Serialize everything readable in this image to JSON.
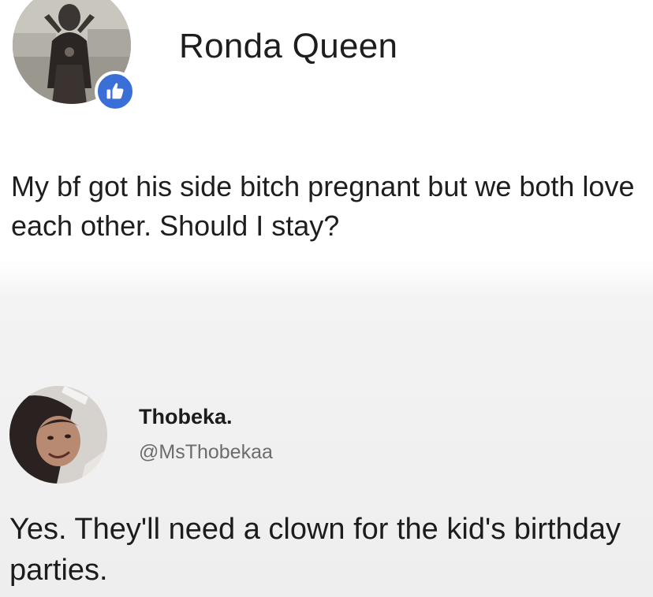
{
  "facebook_post": {
    "author_name": "Ronda Queen",
    "avatar_badge_icon": "like-thumbs-up-icon",
    "badge_color": "#3b6fd8",
    "text": "My bf got his side bitch pregnant but we both love each other. Should I stay?"
  },
  "tweet_reply": {
    "display_name": "Thobeka.",
    "handle": "@MsThobekaa",
    "text": "Yes. They'll need a clown for the kid's birthday parties."
  }
}
